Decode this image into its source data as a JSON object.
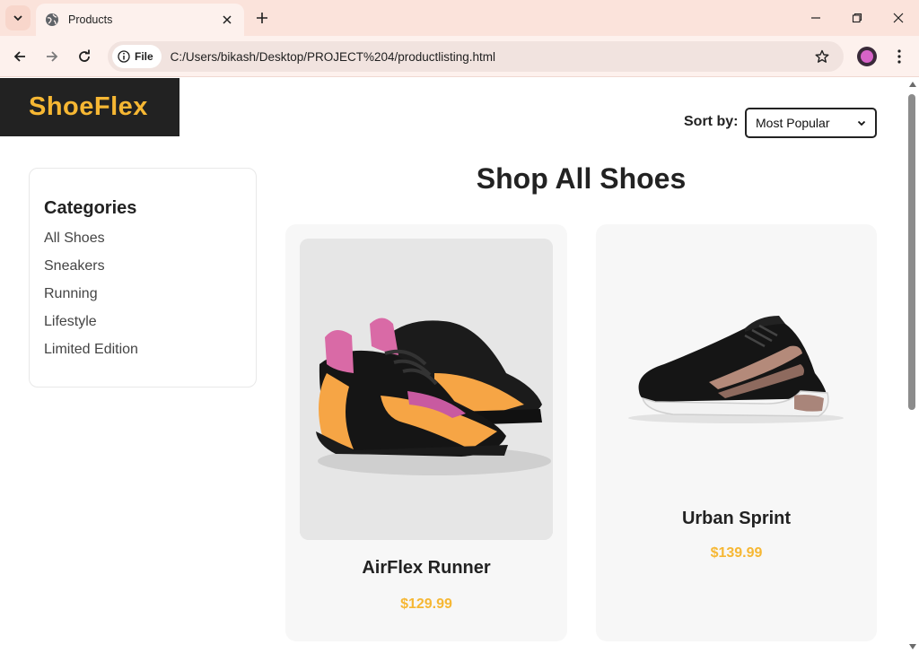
{
  "browser": {
    "tab_title": "Products",
    "site_chip_label": "File",
    "url": "C:/Users/bikash/Desktop/PROJECT%204/productlisting.html"
  },
  "header": {
    "logo": "ShoeFlex",
    "sort_label": "Sort by:",
    "sort_selected": "Most Popular"
  },
  "sidebar": {
    "title": "Categories",
    "items": [
      "All Shoes",
      "Sneakers",
      "Running",
      "Lifestyle",
      "Limited Edition"
    ]
  },
  "main": {
    "title": "Shop All Shoes",
    "products": [
      {
        "name": "AirFlex Runner",
        "price": "$129.99"
      },
      {
        "name": "Urban Sprint",
        "price": "$139.99"
      }
    ]
  },
  "colors": {
    "accent": "#f6b733",
    "logo_bg": "#222222",
    "tabbar_bg": "#fbe3db"
  }
}
